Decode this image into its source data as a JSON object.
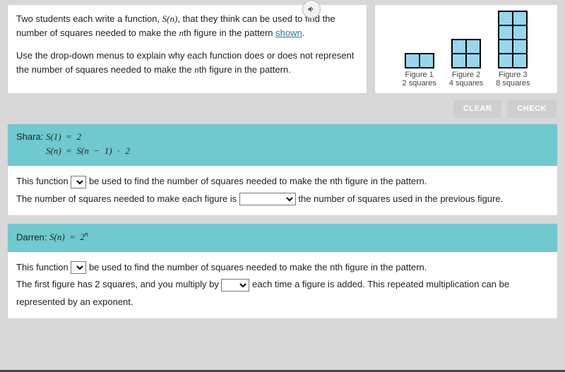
{
  "prompt": {
    "para1_a": "Two students each write a function, ",
    "para1_fn": "S(n)",
    "para1_b": ", that they think can be used to find the number of squares needed to make the ",
    "para1_nth": "n",
    "para1_c": "th figure in the pattern ",
    "para1_link": "shown",
    "para1_d": ".",
    "para2_a": "Use the drop-down menus to explain why each function does or does not represent the number of squares needed to make the ",
    "para2_nth": "n",
    "para2_b": "th figure in the pattern."
  },
  "figures": {
    "f1_label": "Figure 1",
    "f1_count": "2 squares",
    "f2_label": "Figure 2",
    "f2_count": "4 squares",
    "f3_label": "Figure 3",
    "f3_count": "8 squares"
  },
  "buttons": {
    "clear": "CLEAR",
    "check": "CHECK"
  },
  "shara": {
    "name": "Shara:",
    "eq1_left": "S(1)",
    "eq1_op": " = ",
    "eq1_right": "2",
    "eq2_left": "S(n)",
    "eq2_op": " = ",
    "eq2_right_a": "S(n",
    "eq2_minus": " − ",
    "eq2_right_b": "1)",
    "eq2_dot": " · ",
    "eq2_right_c": "2",
    "sent1_a": "This function ",
    "sent1_b": " be used to find the number of squares needed to make the ",
    "sent1_nth": "n",
    "sent1_c": "th figure in the pattern.",
    "sent2_a": "The number of squares needed to make each figure is ",
    "sent2_b": " the number of squares used in the previous figure."
  },
  "darren": {
    "name": "Darren:",
    "eq_left": "S(n)",
    "eq_op": " = ",
    "eq_base": "2",
    "eq_exp": "n",
    "sent1_a": "This function ",
    "sent1_b": " be used to find the number of squares needed to make the ",
    "sent1_nth": "n",
    "sent1_c": "th figure in the pattern.",
    "sent2_a": "The first figure has 2 squares, and you multiply by ",
    "sent2_b": " each time a figure is added. This repeated multiplication can be represented by an exponent."
  }
}
